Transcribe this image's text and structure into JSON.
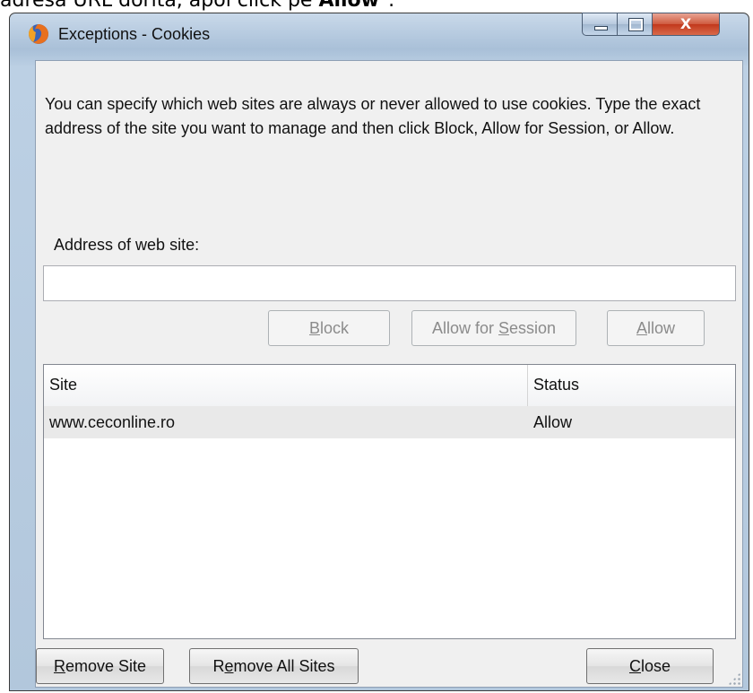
{
  "caption": {
    "prefix": "adresa URL dorita, apoi click pe ",
    "bold": "Allow",
    "suffix": "\"."
  },
  "window": {
    "title": "Exceptions - Cookies",
    "icon": "firefox-icon",
    "controls": {
      "minimize": "minimize-icon",
      "maximize": "maximize-icon",
      "close_glyph": "X"
    }
  },
  "dialog": {
    "description": "You can specify which web sites are always or never allowed to use cookies. Type the exact address of the site you want to manage and then click Block, Allow for Session, or Allow.",
    "address_label": "Address of web site:",
    "address_value": "",
    "buttons": {
      "block": {
        "pre": "",
        "accel": "B",
        "post": "lock"
      },
      "allow_session": {
        "pre": "Allow for ",
        "accel": "S",
        "post": "ession"
      },
      "allow": {
        "pre": "",
        "accel": "A",
        "post": "llow"
      },
      "remove_site": {
        "pre": "",
        "accel": "R",
        "post": "emove Site"
      },
      "remove_all": {
        "pre": "R",
        "accel": "e",
        "post": "move All Sites"
      },
      "close": {
        "pre": "",
        "accel": "C",
        "post": "lose"
      }
    }
  },
  "table": {
    "columns": [
      "Site",
      "Status"
    ],
    "rows": [
      {
        "site": "www.ceconline.ro",
        "status": "Allow"
      }
    ]
  },
  "colors": {
    "frame": "#b2c7dc",
    "client": "#f0f0f0",
    "close_button": "#c2381c",
    "selected_row": "#e9e9e9"
  }
}
